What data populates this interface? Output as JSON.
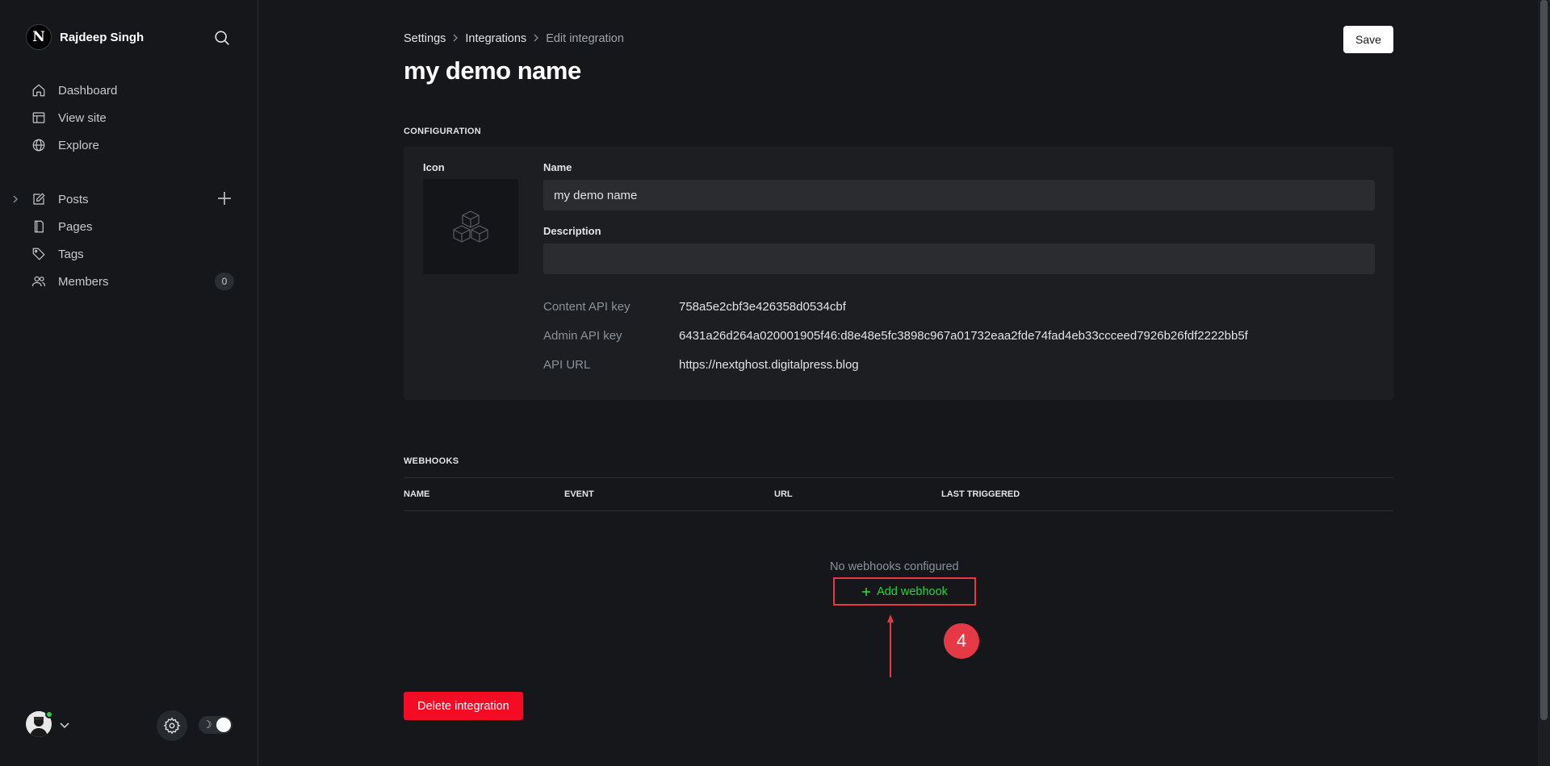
{
  "sidebar": {
    "brand_initial": "N",
    "user_name": "Rajdeep Singh",
    "nav": [
      {
        "label": "Dashboard",
        "icon": "home-icon"
      },
      {
        "label": "View site",
        "icon": "layout-icon"
      },
      {
        "label": "Explore",
        "icon": "globe-icon"
      }
    ],
    "content_nav": [
      {
        "label": "Posts",
        "icon": "edit-icon"
      },
      {
        "label": "Pages",
        "icon": "page-icon"
      },
      {
        "label": "Tags",
        "icon": "tag-icon"
      },
      {
        "label": "Members",
        "icon": "members-icon",
        "count": "0"
      }
    ],
    "theme_moon": "☽"
  },
  "header": {
    "breadcrumb": [
      "Settings",
      "Integrations",
      "Edit integration"
    ],
    "title": "my demo name",
    "save_label": "Save"
  },
  "configuration": {
    "section_label": "CONFIGURATION",
    "icon_label": "Icon",
    "name_label": "Name",
    "name_value": "my demo name",
    "description_label": "Description",
    "description_value": "",
    "content_api_key_label": "Content API key",
    "content_api_key": "758a5e2cbf3e426358d0534cbf",
    "admin_api_key_label": "Admin API key",
    "admin_api_key": "6431a26d264a020001905f46:d8e48e5fc3898c967a01732eaa2fde74fad4eb33ccceed7926b26fdf2222bb5f",
    "api_url_label": "API URL",
    "api_url": "https://nextghost.digitalpress.blog"
  },
  "webhooks": {
    "section_label": "WEBHOOKS",
    "columns": [
      "NAME",
      "EVENT",
      "URL",
      "LAST TRIGGERED"
    ],
    "empty_text": "No webhooks configured",
    "add_label": "Add webhook"
  },
  "annotation": {
    "step": "4",
    "color": "#e63946"
  },
  "delete_label": "Delete integration",
  "colors": {
    "accent_green": "#30cf43",
    "danger": "#f50b23",
    "background": "#15171a"
  }
}
